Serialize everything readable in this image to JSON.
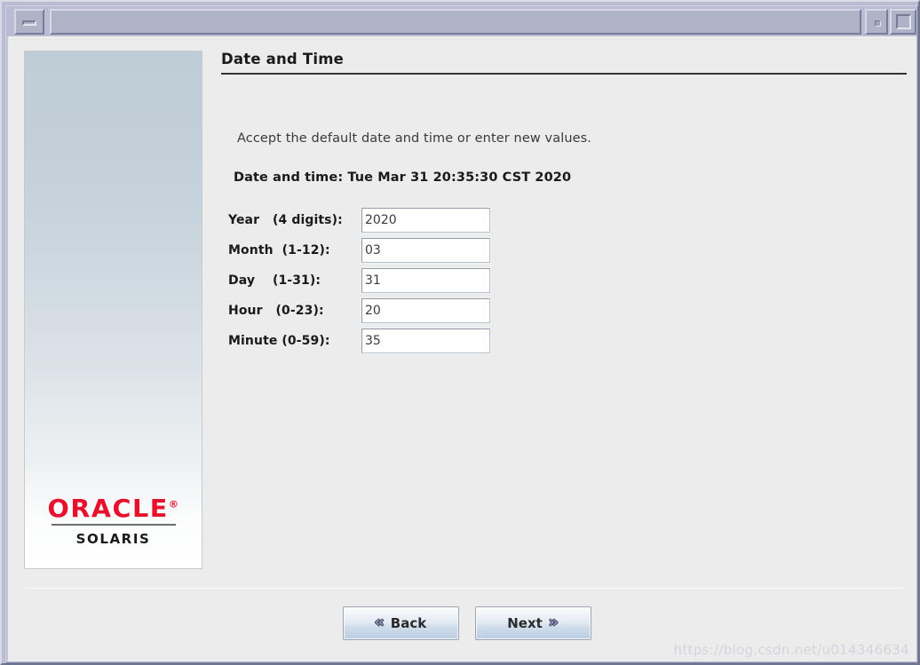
{
  "window": {
    "titlebar": {
      "title": "",
      "minimize_icon": "minimize-icon",
      "restore_icon": "restore-icon",
      "maximize_icon": "maximize-icon"
    }
  },
  "sidebar": {
    "brand": {
      "wordmark": "ORACLE",
      "trademark": "®",
      "product": "SOLARIS"
    },
    "gradient_top": "#bfcdd7",
    "gradient_bottom": "#ffffff"
  },
  "main": {
    "heading": "Date and Time",
    "intro_text": "Accept the default date and time or enter new values.",
    "current_datetime_label": "Date and time: Tue Mar 31 20:35:30 CST 2020",
    "fields": [
      {
        "label": "Year   (4 digits):",
        "value": "2020",
        "name": "year"
      },
      {
        "label": "Month  (1-12):",
        "value": "03",
        "name": "month"
      },
      {
        "label": "Day    (1-31):",
        "value": "31",
        "name": "day"
      },
      {
        "label": "Hour   (0-23):",
        "value": "20",
        "name": "hour"
      },
      {
        "label": "Minute (0-59):",
        "value": "35",
        "name": "minute"
      }
    ]
  },
  "footer": {
    "back_button": {
      "label": "Back",
      "chevron": "«"
    },
    "next_button": {
      "label": "Next",
      "chevron": "»"
    }
  },
  "watermark": "https://blog.csdn.net/u014346634",
  "colors": {
    "titlebar": "#aeb3c8",
    "frame": "#b9bcd2",
    "content_bg": "#ececed",
    "oracle_red": "#e8112d",
    "chevron": "#9093b9"
  }
}
